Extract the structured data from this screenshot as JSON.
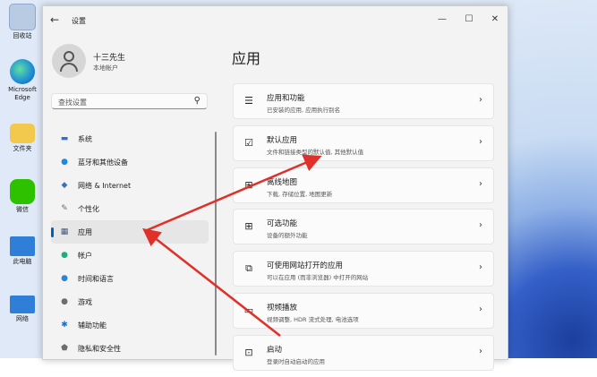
{
  "desktop": {
    "icons": [
      {
        "label": "回收站",
        "glyph": "recycle-bin-icon",
        "color": "#9fb8d6"
      },
      {
        "label": "Microsoft Edge",
        "glyph": "edge-icon",
        "color": "#2f8fd8"
      },
      {
        "label": "文件夹",
        "glyph": "folder-icon",
        "color": "#f2c94c"
      },
      {
        "label": "微信",
        "glyph": "wechat-icon",
        "color": "#2dc100"
      },
      {
        "label": "此电脑",
        "glyph": "computer-icon",
        "color": "#2f7fd8"
      },
      {
        "label": "网络",
        "glyph": "network-icon",
        "color": "#2f7fd8"
      }
    ]
  },
  "window": {
    "title": "设置",
    "back": "←",
    "minimize": "—",
    "maximize": "☐",
    "close": "✕"
  },
  "profile": {
    "name": "十三先生",
    "account": "本地帐户"
  },
  "search": {
    "placeholder": "查找设置",
    "icon": "⚲"
  },
  "nav": {
    "items": [
      {
        "label": "系统",
        "icon": "▬",
        "color": "#2f6fd8"
      },
      {
        "label": "蓝牙和其他设备",
        "icon": "●",
        "color": "#1e88e5"
      },
      {
        "label": "网络 & Internet",
        "icon": "◆",
        "color": "#3b6fb6"
      },
      {
        "label": "个性化",
        "icon": "✎",
        "color": "#6d6d6d"
      },
      {
        "label": "应用",
        "icon": "▦",
        "color": "#3d5a80",
        "selected": true
      },
      {
        "label": "帐户",
        "icon": "●",
        "color": "#1fae7a"
      },
      {
        "label": "时间和语言",
        "icon": "●",
        "color": "#2a86d4"
      },
      {
        "label": "游戏",
        "icon": "●",
        "color": "#6d6d6d"
      },
      {
        "label": "辅助功能",
        "icon": "✱",
        "color": "#1e6fd0"
      },
      {
        "label": "隐私和安全性",
        "icon": "⬟",
        "color": "#6d6d6d"
      }
    ]
  },
  "main": {
    "title": "应用",
    "cards": [
      {
        "title": "应用和功能",
        "subtitle": "已安装的应用, 应用执行别名",
        "icon": "☰"
      },
      {
        "title": "默认应用",
        "subtitle": "文件和链接类型的默认值, 其他默认值",
        "icon": "☑"
      },
      {
        "title": "离线地图",
        "subtitle": "下载, 存储位置, 地图更新",
        "icon": "⊞"
      },
      {
        "title": "可选功能",
        "subtitle": "设备的额外功能",
        "icon": "⊞"
      },
      {
        "title": "可使用网站打开的应用",
        "subtitle": "可以在应用 (而非浏览器) 中打开的网站",
        "icon": "⧉"
      },
      {
        "title": "视频播放",
        "subtitle": "视频调整, HDR 流式处理, 电池选项",
        "icon": "▭"
      },
      {
        "title": "启动",
        "subtitle": "登录时自动启动的应用",
        "icon": "⊡"
      }
    ],
    "chevron": "›"
  },
  "colors": {
    "accent": "#005fb8",
    "annotation_arrow": "#e0302a"
  }
}
